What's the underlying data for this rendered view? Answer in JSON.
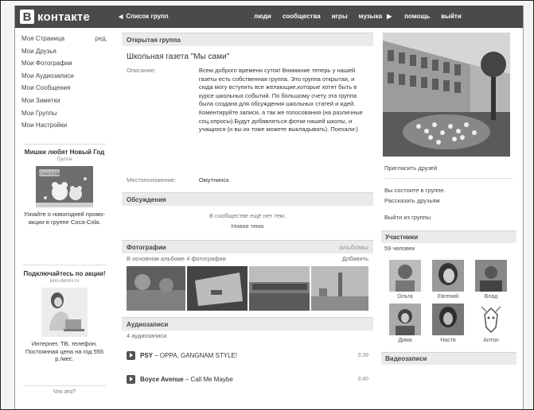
{
  "header": {
    "logo_letter": "В",
    "logo_text": "контакте",
    "group_list": "Список групп",
    "nav": [
      "люди",
      "сообщества",
      "игры",
      "музыка",
      "помощь",
      "выйти"
    ]
  },
  "sidebar": {
    "items": [
      {
        "label": "Моя Страница",
        "extra": "ред."
      },
      {
        "label": "Мои Друзья"
      },
      {
        "label": "Мои Фотографии"
      },
      {
        "label": "Мои Аудиозаписи"
      },
      {
        "label": "Мои Сообщения"
      },
      {
        "label": "Мои Заметки"
      },
      {
        "label": "Мои Группы"
      },
      {
        "label": "Мои Настройки"
      }
    ]
  },
  "ads": [
    {
      "title": "Мишки любят Новый Год",
      "sub": "Группа",
      "text": "Узнайте о новогодней промо-акции в группе Coca-Cola.",
      "img_text": "Coca-Cola"
    },
    {
      "title": "Подключайтесь по акции!",
      "sub": "kino-domru.ru",
      "text": "Интернет, ТВ, телефон. Постоянная цена на год 555 р./мес."
    }
  ],
  "whatis": "Что это?",
  "group": {
    "section": "Открытая группа",
    "title": "Школьная газета \"Мы сами\"",
    "desc_label": "Описание:",
    "description": "Всем доброго времени суток! Внимание теперь у нашей газеты есть собственная группа. Это группа открытая, и сюда могу вступить все желающие,которые хотят быть в курсе школьных событий. По большому счету эта группа была создана для обсуждения школьных статей и идей. Коментируйте записи, а так же голосования (на различные соц.опросы).Будут добавляться фотки нашей школы, и учащихся (и вы их тоже можете выкладывать). Поехали:)",
    "loc_label": "Местоположение:",
    "location": "Омутнинск"
  },
  "discussions": {
    "title": "Обсуждения",
    "empty": "В сообществе ещё нет тем.",
    "new_topic": "Новая тема"
  },
  "photos": {
    "title": "Фотографии",
    "albums": "альбомы",
    "subtitle": "В основном альбоме 4 фотографии",
    "add": "Добавить"
  },
  "audio": {
    "title": "Аудиозаписи",
    "count": "4 аудиозаписи",
    "tracks": [
      {
        "artist": "PSY",
        "song": " – OPPA, GANGNAM STYLE!",
        "duration": "3:39"
      },
      {
        "artist": "Boyce Avenue",
        "song": " – Call Me Maybe",
        "duration": "3:40"
      }
    ]
  },
  "right": {
    "invite": "Пригласить друзей",
    "member_status": "Вы состоите в группе.",
    "tell_friends": "Рассказать друзьям",
    "leave": "Выйти из группы",
    "members_title": "Участники",
    "members_count": "59 человек",
    "members": [
      "Ольга",
      "Евгений",
      "Влад",
      "Дима",
      "Настя",
      "Антон"
    ],
    "videos_title": "Видеозаписи"
  }
}
